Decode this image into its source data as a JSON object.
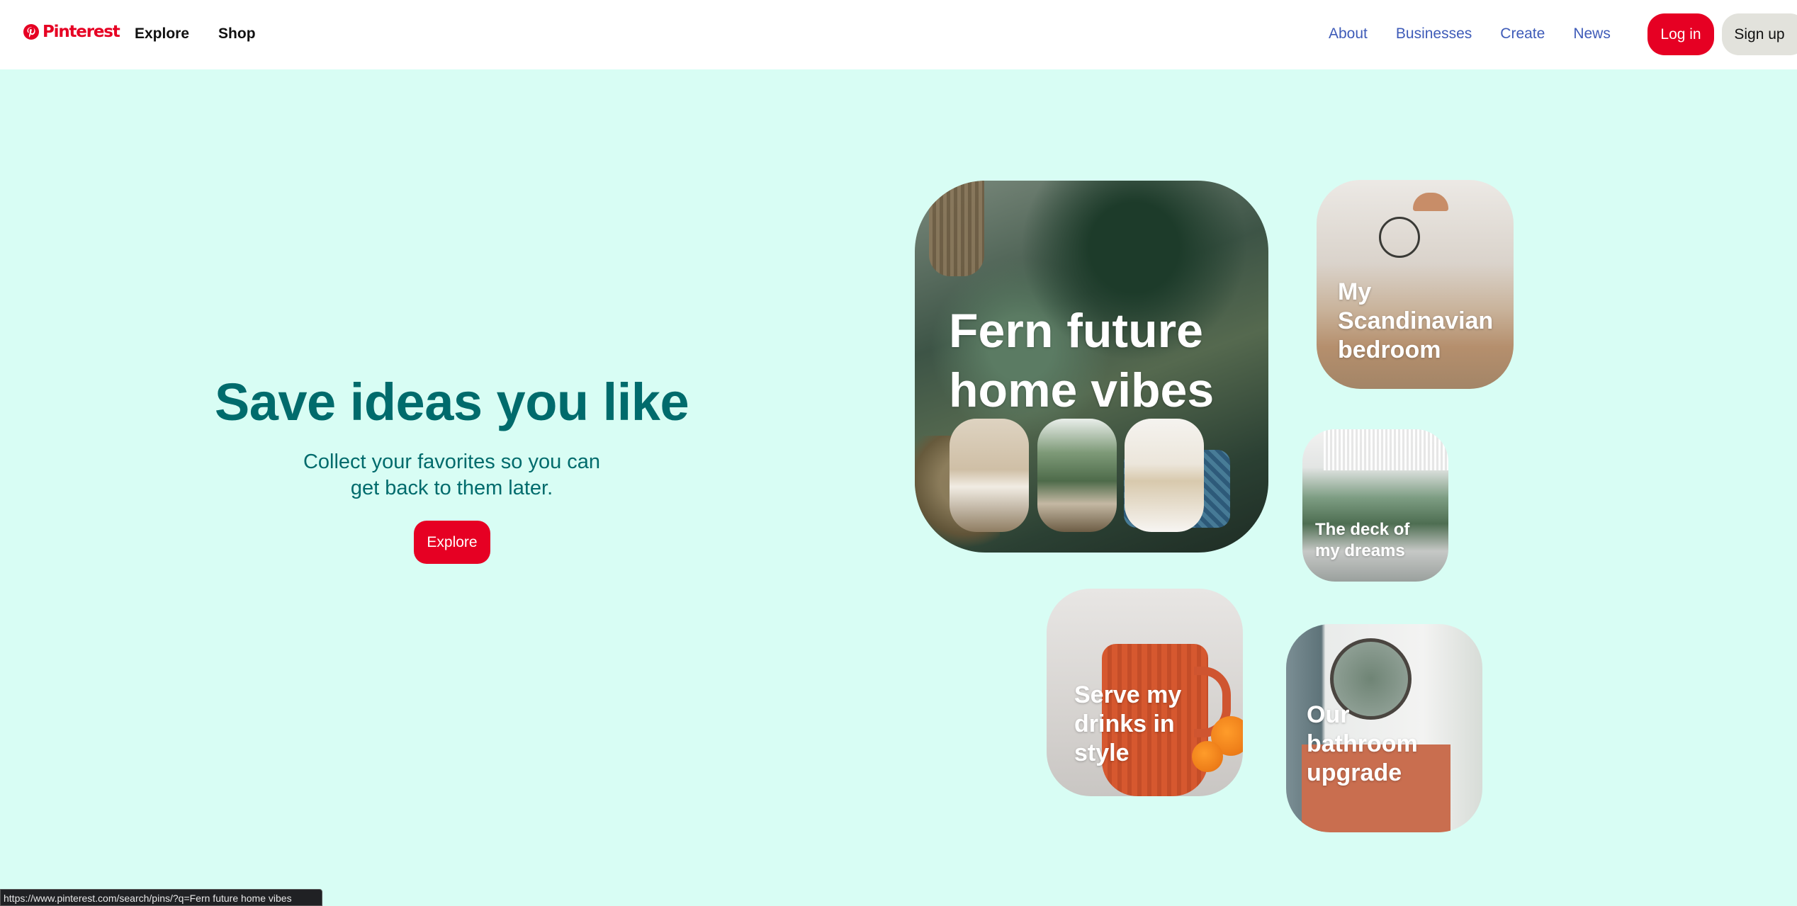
{
  "header": {
    "brand": "Pinterest",
    "nav_left": [
      "Explore",
      "Shop"
    ],
    "nav_right": [
      "About",
      "Businesses",
      "Create",
      "News"
    ],
    "login_label": "Log in",
    "signup_label": "Sign up"
  },
  "hero": {
    "title": "Save ideas you like",
    "subtitle_line1": "Collect your favorites so you can",
    "subtitle_line2": "get back to them later.",
    "button_label": "Explore"
  },
  "cards": {
    "fern": {
      "line1": "Fern future",
      "line2": "home vibes"
    },
    "scandinavian": {
      "line1": "My",
      "line2": "Scandinavian",
      "line3": "bedroom"
    },
    "deck": {
      "line1": "The deck of",
      "line2": "my dreams"
    },
    "drinks": {
      "line1": "Serve my",
      "line2": "drinks in",
      "line3": "style"
    },
    "bathroom": {
      "line1": "Our",
      "line2": "bathroom",
      "line3": "upgrade"
    }
  },
  "status_bar": {
    "url": "https://www.pinterest.com/search/pins/?q=Fern future home vibes"
  },
  "colors": {
    "brand_red": "#e60023",
    "hero_bg": "#d8fdf4",
    "hero_text": "#006b6c",
    "nav_link_blue": "#3e5bb8"
  }
}
